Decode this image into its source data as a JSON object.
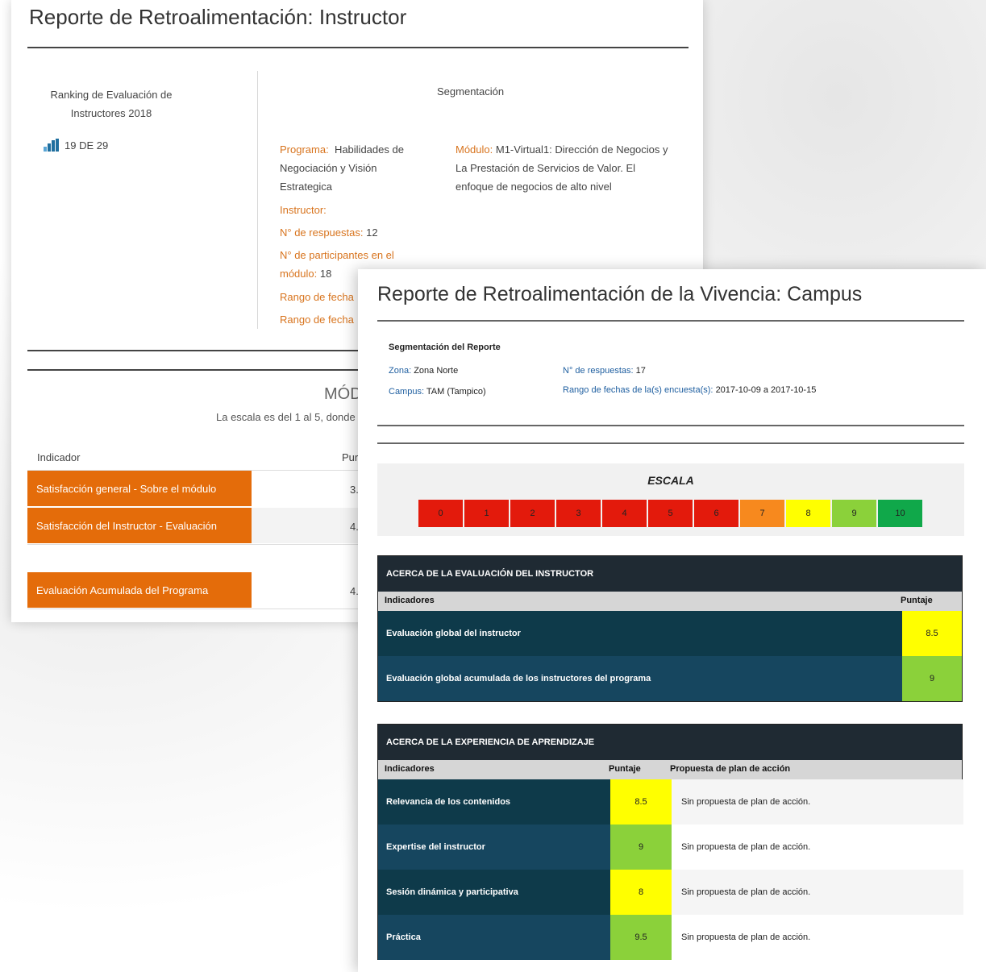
{
  "back_report": {
    "title": "Reporte de Retroalimentación: Instructor",
    "ranking": {
      "label": "Ranking de Evaluación de Instructores 2018",
      "value": "19 DE 29"
    },
    "segmentation_title": "Segmentación",
    "programa_key": "Programa:",
    "programa_val": "Habilidades de Negociación y Visión Estrategica",
    "modulo_key": "Módulo:",
    "modulo_val": "M1-Virtual1: Dirección de Negocios y La Prestación de Servicios de Valor. El enfoque de negocios de alto nivel",
    "instructor_key": "Instructor:",
    "respuestas_key": "N° de respuestas:",
    "respuestas_val": "12",
    "participantes_key": "N° de participantes en el módulo:",
    "participantes_val": "18",
    "rango1_key": "Rango de fecha",
    "rango2_key": "Rango de fecha",
    "module_heading": "MÓD",
    "scale_note": "La escala es del 1 al 5, donde",
    "col_indicador": "Indicador",
    "col_puntaje": "Pur",
    "rows": [
      {
        "label": "Satisfacción general - Sobre el módulo",
        "value": "3."
      },
      {
        "label": "Satisfacción del Instructor - Evaluación",
        "value": "4."
      },
      {
        "label": "Evaluación Acumulada del Programa",
        "value": "4."
      }
    ]
  },
  "front_report": {
    "title": "Reporte de Retroalimentación de la Vivencia: Campus",
    "seg_title": "Segmentación del Reporte",
    "zona_key": "Zona:",
    "zona_val": "Zona Norte",
    "campus_key": "Campus:",
    "campus_val": "TAM (Tampico)",
    "respuestas_key": "N° de respuestas:",
    "respuestas_val": "17",
    "rango_key": "Rango de fechas de la(s) encuesta(s):",
    "rango_val": "2017-10-09 a 2017-10-15",
    "escala_title": "ESCALA",
    "scale": [
      {
        "label": "0",
        "color": "#e31a0c"
      },
      {
        "label": "1",
        "color": "#e31a0c"
      },
      {
        "label": "2",
        "color": "#e31a0c"
      },
      {
        "label": "3",
        "color": "#e31a0c"
      },
      {
        "label": "4",
        "color": "#e31a0c"
      },
      {
        "label": "5",
        "color": "#e31a0c"
      },
      {
        "label": "6",
        "color": "#e31a0c"
      },
      {
        "label": "7",
        "color": "#f7891e"
      },
      {
        "label": "8",
        "color": "#ffff00"
      },
      {
        "label": "9",
        "color": "#8bd13a"
      },
      {
        "label": "10",
        "color": "#10a84a"
      }
    ],
    "instructor_table": {
      "header": "ACERCA DE LA EVALUACIÓN DEL INSTRUCTOR",
      "col_indicadores": "Indicadores",
      "col_puntaje": "Puntaje",
      "rows": [
        {
          "label": "Evaluación global del instructor",
          "score": "8.5",
          "color": "#ffff00"
        },
        {
          "label": "Evaluación global acumulada de los instructores del programa",
          "score": "9",
          "color": "#8bd13a"
        }
      ]
    },
    "experience_table": {
      "header": "ACERCA DE LA EXPERIENCIA DE APRENDIZAJE",
      "col_indicadores": "Indicadores",
      "col_puntaje": "Puntaje",
      "col_plan": "Propuesta de plan de acción",
      "rows": [
        {
          "label": "Relevancia de los contenidos",
          "score": "8.5",
          "color": "#ffff00",
          "plan": "Sin propuesta de plan de acción."
        },
        {
          "label": "Expertise del instructor",
          "score": "9",
          "color": "#8bd13a",
          "plan": "Sin propuesta de plan de acción."
        },
        {
          "label": "Sesión dinámica y participativa",
          "score": "8",
          "color": "#ffff00",
          "plan": "Sin propuesta de plan de acción."
        },
        {
          "label": "Práctica",
          "score": "9.5",
          "color": "#8bd13a",
          "plan": "Sin propuesta de plan de acción."
        }
      ]
    }
  }
}
